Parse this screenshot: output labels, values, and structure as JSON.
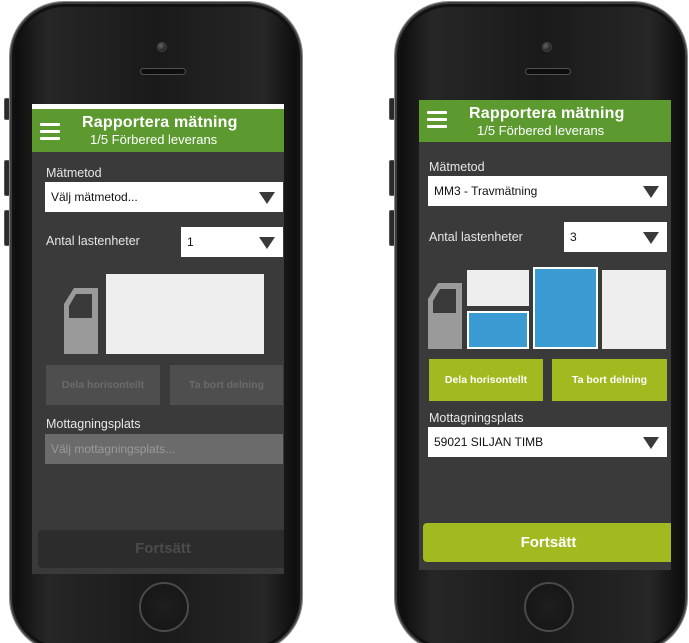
{
  "app": {
    "title": "Rapportera mätning",
    "step": "1/5 Förbered leverans"
  },
  "colors": {
    "header_green": "#5c9a30",
    "action_lime": "#a2ba1f",
    "selected_blue": "#3a9bd2",
    "screen_bg": "#3a3a3a"
  },
  "left": {
    "measure_label": "Mätmetod",
    "measure_value": "Välj mätmetod...",
    "units_label": "Antal lastenheter",
    "units_value": "1",
    "split_button": "Dela horisontellt",
    "remove_split_button": "Ta bort delning",
    "reception_label": "Mottagningsplats",
    "reception_placeholder": "Välj mottagningsplats...",
    "continue_button": "Fortsätt"
  },
  "right": {
    "measure_label": "Mätmetod",
    "measure_value": "MM3 - Travmätning",
    "units_label": "Antal lastenheter",
    "units_value": "3",
    "split_button": "Dela horisontellt",
    "remove_split_button": "Ta bort delning",
    "reception_label": "Mottagningsplats",
    "reception_value": "59021 SILJAN TIMB",
    "continue_button": "Fortsätt"
  },
  "icons": {
    "menu": "hamburger-icon",
    "dropdown": "caret-down-icon",
    "truck": "truck-cab-icon"
  }
}
